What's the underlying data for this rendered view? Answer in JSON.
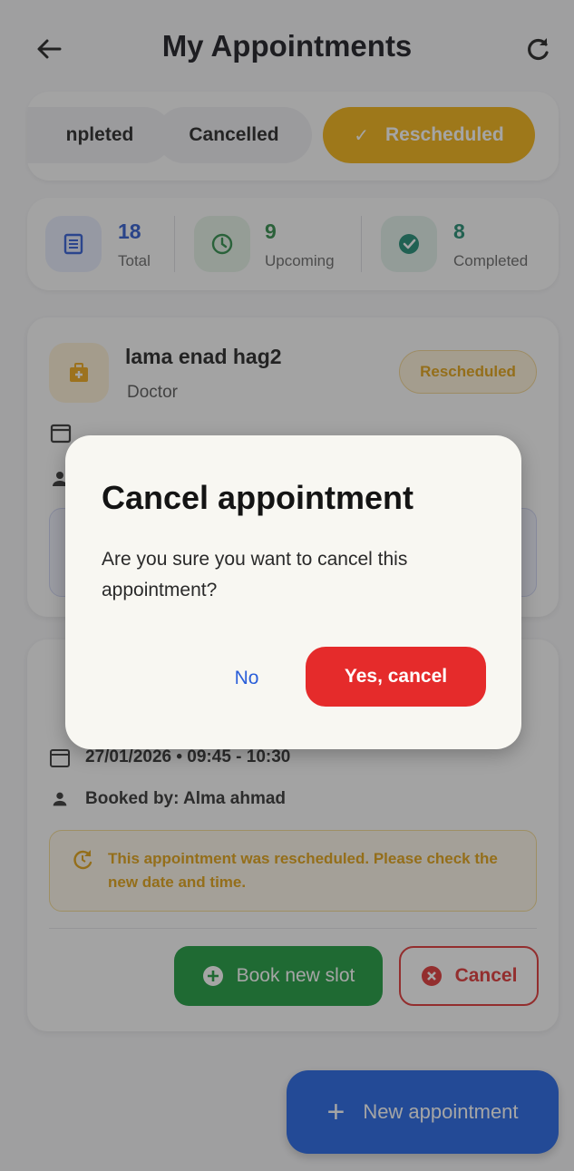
{
  "appbar": {
    "title": "My Appointments",
    "back_icon": "arrow-left-icon",
    "refresh_icon": "refresh-icon"
  },
  "tabs": {
    "completed_label": "npleted",
    "cancelled_label": "Cancelled",
    "rescheduled_label": "Rescheduled",
    "rescheduled_check": "✓"
  },
  "stats": {
    "total": {
      "value": "18",
      "label": "Total"
    },
    "upcoming": {
      "value": "9",
      "label": "Upcoming"
    },
    "completed": {
      "value": "8",
      "label": "Completed"
    }
  },
  "cards": [
    {
      "name": "lama enad hag2",
      "role": "Doctor",
      "status": "Rescheduled"
    },
    {
      "date_time": "27/01/2026 • 09:45 - 10:30",
      "booked_by": "Booked by: Alma ahmad",
      "note": "This appointment was rescheduled. Please check the new date and time.",
      "book_new_slot": "Book new slot",
      "cancel": "Cancel"
    }
  ],
  "fab": {
    "label": "New appointment"
  },
  "dialog": {
    "title": "Cancel appointment",
    "message": "Are you sure you want to cancel this appointment?",
    "no_label": "No",
    "yes_label": "Yes, cancel"
  },
  "colors": {
    "accent_amber": "#f3b211",
    "primary_blue": "#1f63e6",
    "danger_red": "#e52b2b",
    "success_green": "#199a3c"
  }
}
